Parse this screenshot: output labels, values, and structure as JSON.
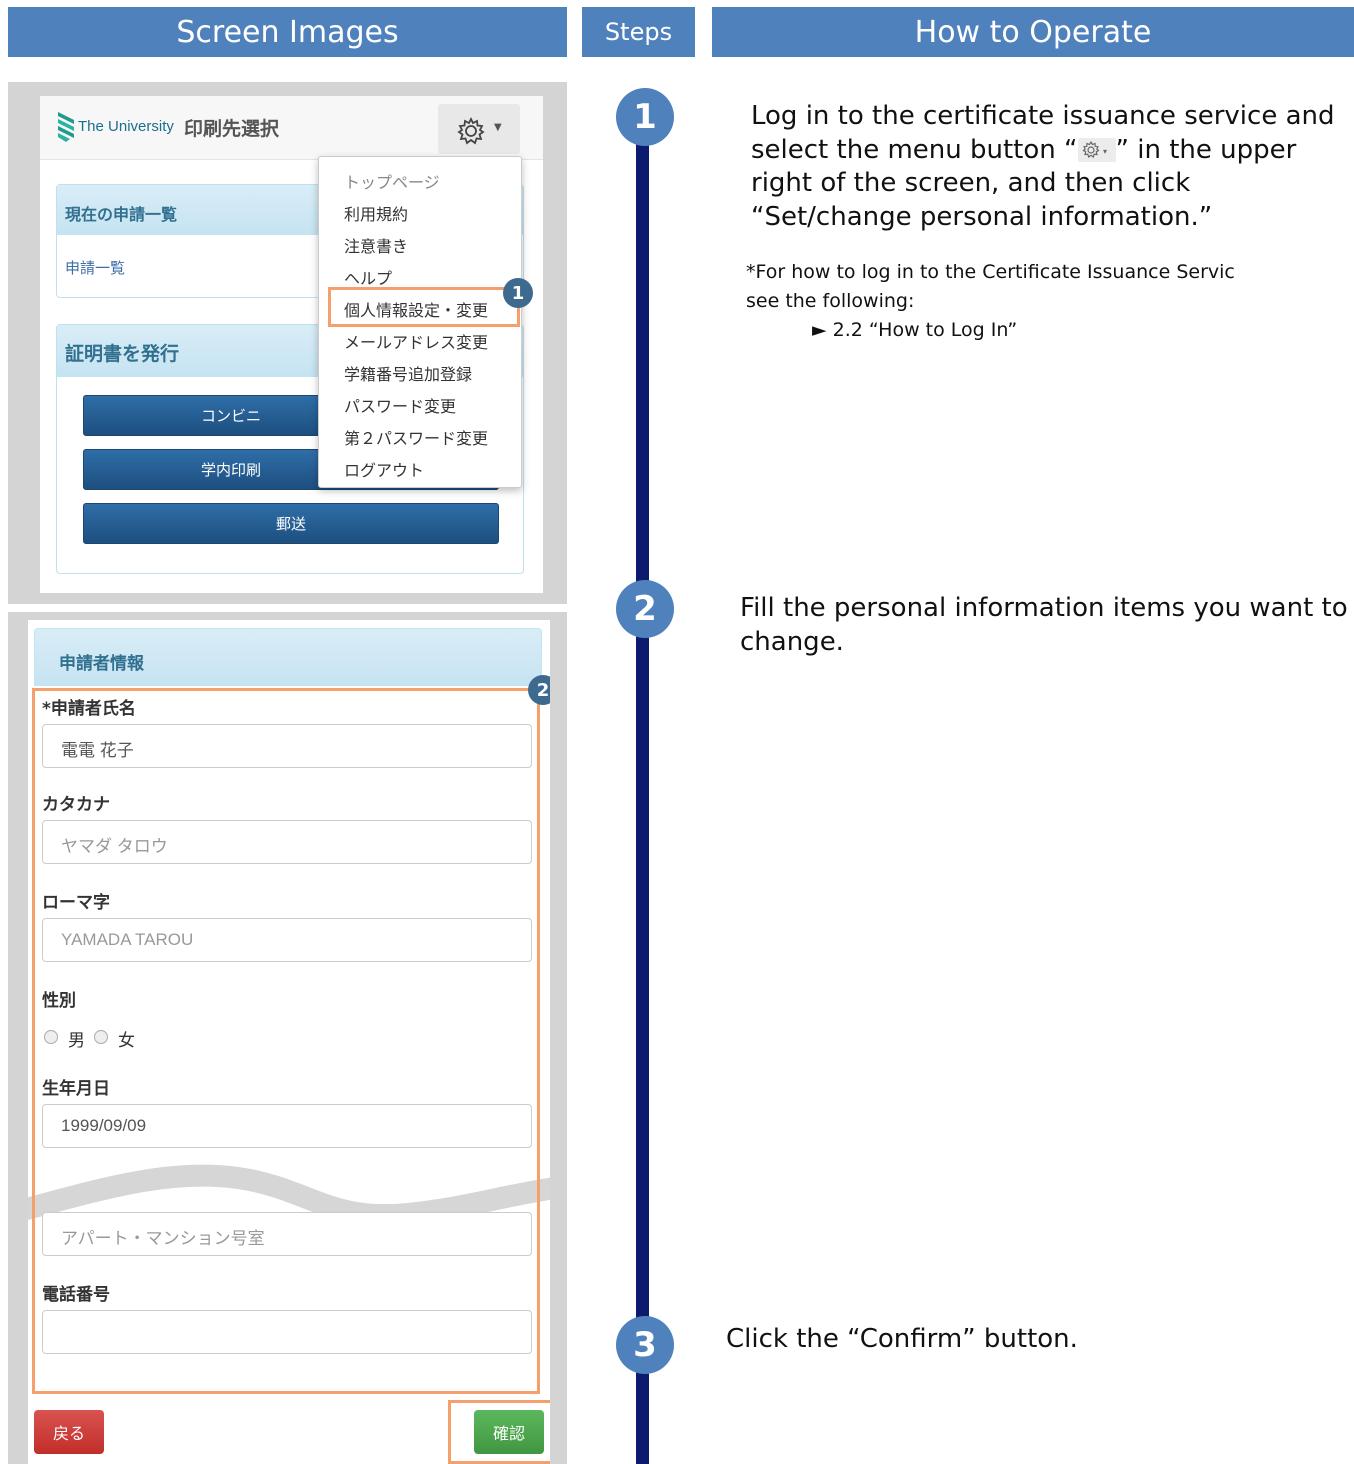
{
  "headers": {
    "screen_images": "Screen Images",
    "steps": "Steps",
    "how_to_operate": "How to Operate"
  },
  "screen1": {
    "brand": "The University",
    "title": "印刷先選択",
    "card1_title": "現在の申請一覧",
    "card1_link": "申請一覧",
    "card2_title": "証明書を発行",
    "btn_convenience": "コンビニ",
    "btn_campus": "学内印刷",
    "btn_mail": "郵送",
    "menu": [
      "トップページ",
      "利用規約",
      "注意書き",
      "ヘルプ",
      "個人情報設定・変更",
      "メールアドレス変更",
      "学籍番号追加登録",
      "パスワード変更",
      "第２パスワード変更",
      "ログアウト"
    ]
  },
  "screen2": {
    "section_title": "申請者情報",
    "name_label": "*申請者氏名",
    "name_value": "電電 花子",
    "kana_label": "カタカナ",
    "kana_placeholder": "ヤマダ タロウ",
    "roman_label": "ローマ字",
    "roman_placeholder": "YAMADA TAROU",
    "gender_label": "性別",
    "gender_male": "男",
    "gender_female": "女",
    "dob_label": "生年月日",
    "dob_value": "1999/09/09",
    "apt_placeholder": "アパート・マンション号室",
    "phone_label": "電話番号",
    "phone_value": "",
    "back_button": "戻る",
    "confirm_button": "確認"
  },
  "badges": {
    "b1": "1",
    "b2": "2",
    "b3": "3"
  },
  "steps": {
    "s1": "1",
    "s2": "2",
    "s3": "3"
  },
  "instructions": {
    "step1_part1": "Log in to the certificate issuance service and select the menu button “",
    "step1_part2": "” in the upper right of the screen, and then click “Set/change personal information.”",
    "note_line1": "*For how to log in to the Certificate Issuance Servic",
    "note_line2": "see the following:",
    "note_line3": "► 2.2 “How to Log In”",
    "step2": "Fill the personal information items you want to change.",
    "step3": "Click the “Confirm” button."
  },
  "colors": {
    "header_blue": "#4f81bd",
    "timeline_navy": "#0d1b6e",
    "highlight_orange": "#f5a06c",
    "badge_blue": "#3d6a8e",
    "button_blue": "#2f6ea8",
    "button_red": "#d9534f",
    "button_green": "#5cb85c"
  }
}
